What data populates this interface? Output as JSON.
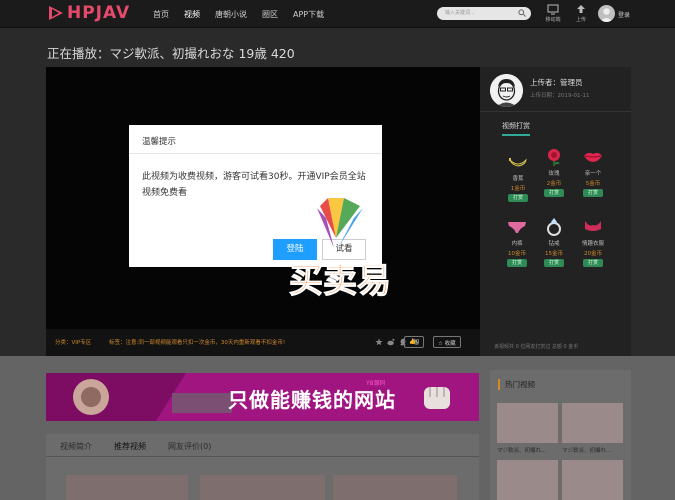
{
  "header": {
    "logo": "HPJAV",
    "nav": [
      "首页",
      "视频",
      "唐朝小说",
      "圈区",
      "APP下载"
    ],
    "search_placeholder": "输入关键词...",
    "mobile_label": "移动端",
    "upload_label": "上传",
    "login_label": "登录"
  },
  "page": {
    "title": "正在播放：マジ軟派、初撮れおな 19歳 420"
  },
  "player_bar": {
    "category": "分类：VIP专区",
    "tip": "标签：注意:同一部视频能观看只扣一次金币，30天内重新观看不扣金币!",
    "like_label": "0",
    "fav_label": "☆ 收藏"
  },
  "modal": {
    "title": "温馨提示",
    "message": "此视频为收费视频，游客可试看30秒。开通VIP会员全站视频免费看",
    "primary_btn": "登陆",
    "secondary_btn": "试看"
  },
  "uploader": {
    "name": "上传者：管理员",
    "date": "上传日期：2019-01-11"
  },
  "tips": {
    "title": "视频打赏",
    "gifts": [
      {
        "name": "香蕉",
        "price": "1金币",
        "btn": "打赏",
        "icon": "banana-icon"
      },
      {
        "name": "玫瑰",
        "price": "2金币",
        "btn": "打赏",
        "icon": "rose-icon"
      },
      {
        "name": "亲一个",
        "price": "5金币",
        "btn": "打赏",
        "icon": "lips-icon"
      },
      {
        "name": "内裤",
        "price": "10金币",
        "btn": "打赏",
        "icon": "underwear-icon"
      },
      {
        "name": "钻戒",
        "price": "15金币",
        "btn": "打赏",
        "icon": "ring-icon"
      },
      {
        "name": "情趣衣服",
        "price": "20金币",
        "btn": "打赏",
        "icon": "lingerie-icon"
      }
    ],
    "footer": "该视频共 0 位网友打赏过 总额 0 金币"
  },
  "banner": {
    "text": "只做能赚钱的网站",
    "small": "Y8源码"
  },
  "tabs": [
    "视频简介",
    "推荐视频",
    "网友评价(0)"
  ],
  "hot": {
    "title": "热门视频",
    "captions": [
      "マジ軟派、初撮れ...",
      "マジ軟派、初撮れ..."
    ]
  },
  "watermark": {
    "text": "买卖易"
  },
  "colors": {
    "accent": "#e64a6b",
    "primary_button": "#1e9fff",
    "gold": "#d18a2c",
    "green": "#2e8b57",
    "banner": "#a01580"
  }
}
